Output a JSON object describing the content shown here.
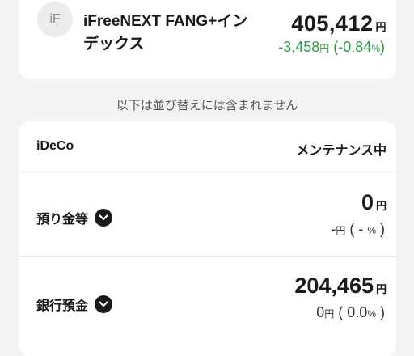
{
  "fund": {
    "avatar": "iF",
    "name": "iFreeNEXT FANG+インデックス",
    "value": "405,412",
    "yen": "円",
    "change": "-3,458",
    "change_yen": "円",
    "pct_open": " (",
    "pct": "-0.84",
    "pct_sign": "%",
    "pct_close": ")",
    "color_change": "#2e9b46"
  },
  "note": "以下は並び替えには含まれません",
  "ideco": {
    "title": "iDeCo",
    "status": "メンテナンス中",
    "rows": [
      {
        "label": "預り金等",
        "amount": "0",
        "yen": "円",
        "sub_value": "-",
        "sub_yen": "円",
        "sub_pct": " ( - ",
        "sub_pct_sign": "%",
        "sub_close": " )"
      },
      {
        "label": "銀行預金",
        "amount": "204,465",
        "yen": "円",
        "sub_value": "0",
        "sub_yen": "円",
        "sub_pct": " ( 0.0",
        "sub_pct_sign": "%",
        "sub_close": " )"
      }
    ]
  },
  "icons": [
    "chevron-down-icon"
  ]
}
